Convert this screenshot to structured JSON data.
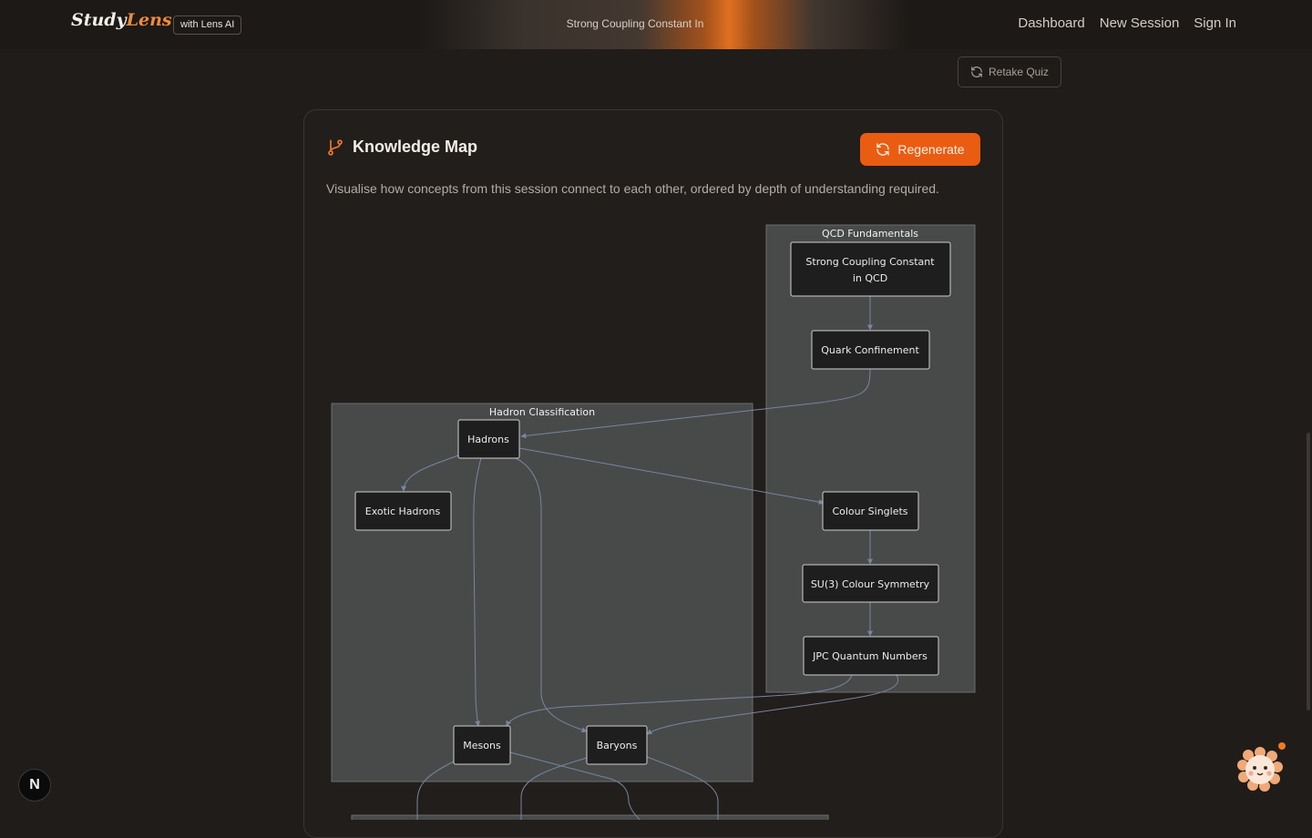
{
  "nav": {
    "logo_study": "Study",
    "logo_lens": "Lens",
    "logo_ai": "AI",
    "badge": "with Lens AI",
    "session_title": "Strong Coupling Constant In",
    "links": [
      "Dashboard",
      "New Session",
      "Sign In"
    ]
  },
  "actions": {
    "retake_label": "Retake Quiz"
  },
  "card": {
    "title": "Knowledge Map",
    "regenerate_label": "Regenerate",
    "description": "Visualise how concepts from this session connect to each other, ordered by depth of understanding required."
  },
  "diagram": {
    "groups": {
      "qcd": "QCD Fundamentals",
      "hadron": "Hadron Classification"
    },
    "nodes": {
      "strong_line1": "Strong Coupling Constant",
      "strong_line2": "in QCD",
      "quark": "Quark Confinement",
      "hadrons": "Hadrons",
      "exotic": "Exotic Hadrons",
      "colour_singlets": "Colour Singlets",
      "su3": "SU(3) Colour Symmetry",
      "jpc": "JPC Quantum Numbers",
      "mesons": "Mesons",
      "baryons": "Baryons"
    }
  },
  "floating": {
    "n_badge": "N"
  },
  "colors": {
    "accent": "#ea5c12",
    "background": "#201c19",
    "group_fill": "#484a4a",
    "node_fill": "#1e1e1e",
    "edge": "#7886a0"
  }
}
